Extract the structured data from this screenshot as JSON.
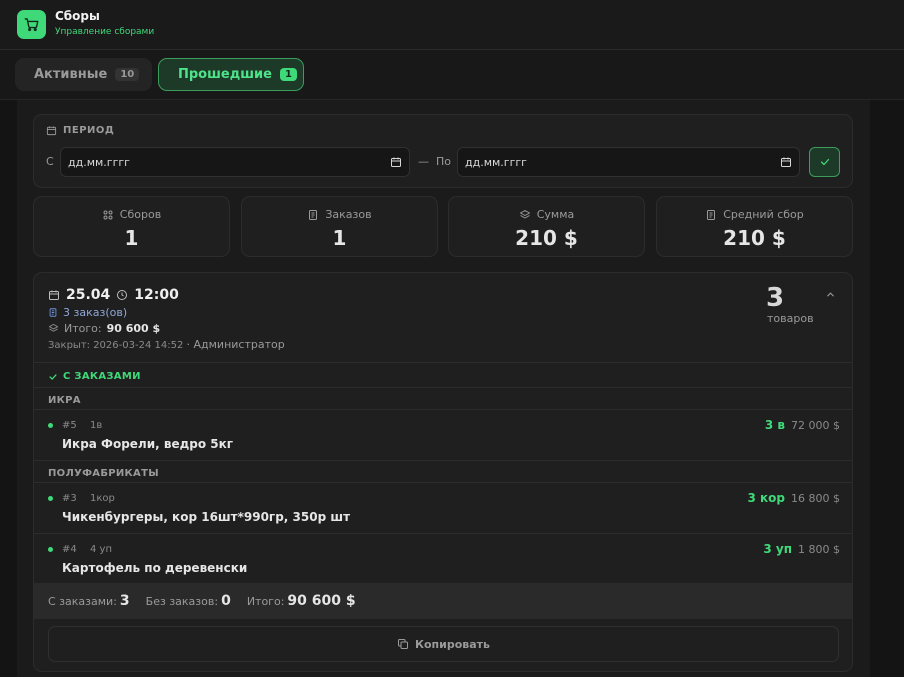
{
  "app": {
    "title": "Сборы",
    "subtitle": "Управление сборами",
    "accent": "#3fd97a"
  },
  "tabs": [
    {
      "label": "Активные",
      "count": "10"
    },
    {
      "label": "Прошедшие",
      "count": "1"
    }
  ],
  "period": {
    "label": "ПЕРИОД",
    "from_label": "С",
    "from_placeholder": "дд.мм.гггг",
    "dash": "—",
    "to_label": "По",
    "to_placeholder": "дд.мм.гггг"
  },
  "stats": [
    {
      "label": "Сборов",
      "value": "1",
      "icon": "grid-icon"
    },
    {
      "label": "Заказов",
      "value": "1",
      "icon": "document-icon"
    },
    {
      "label": "Сумма",
      "value": "210 $",
      "icon": "layers-icon"
    },
    {
      "label": "Средний сбор",
      "value": "210 $",
      "icon": "receipt-icon"
    }
  ],
  "session": {
    "date": "25.04",
    "time": "12:00",
    "orders": "3 заказ(ов)",
    "total_label": "Итого:",
    "total": "90 600 $",
    "closed": "Закрыт: 2026-03-24 14:52",
    "closed_by": "· Администратор",
    "count": "3",
    "count_label": "товаров",
    "with_orders_label": "С ЗАКАЗАМИ",
    "categories": [
      {
        "name": "ИКРА",
        "items": [
          {
            "num": "#5",
            "unit": "1в",
            "name": "Икра Форели, ведро 5кг",
            "qty": "3 в",
            "price": "72 000 $"
          }
        ]
      },
      {
        "name": "ПОЛУФАБРИКАТЫ",
        "items": [
          {
            "num": "#3",
            "unit": "1кор",
            "name": "Чикенбургеры, кор 16шт*990гр, 350р шт",
            "qty": "3 кор",
            "price": "16 800 $"
          },
          {
            "num": "#4",
            "unit": "4 уп",
            "name": "Картофель по деревенски",
            "qty": "3 уп",
            "price": "1 800 $"
          }
        ]
      }
    ],
    "footer": {
      "with_label": "С заказами:",
      "with_value": "3",
      "without_label": "Без заказов:",
      "without_value": "0",
      "total_label": "Итого:",
      "total_value": "90 600 $"
    },
    "copy_label": "Копировать"
  }
}
